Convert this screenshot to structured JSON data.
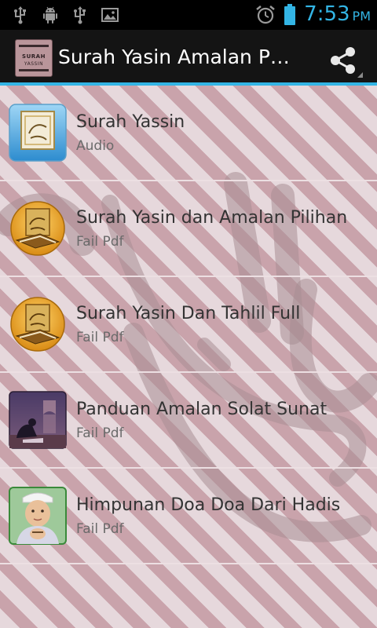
{
  "status_bar": {
    "icons": [
      "usb-icon",
      "android-debug-icon",
      "usb-icon",
      "image-icon",
      "alarm-icon",
      "battery-icon"
    ],
    "time": "7:53",
    "ampm": "PM"
  },
  "action_bar": {
    "app_icon_text_1": "SURAH",
    "app_icon_text_2": "YASSIN",
    "title": "Surah Yasin Amalan Pilihan",
    "share_icon": "share-icon"
  },
  "items": [
    {
      "title": "Surah Yassin",
      "subtitle": "Audio",
      "thumb": "quran-square-icon"
    },
    {
      "title": "Surah Yasin dan Amalan Pilihan",
      "subtitle": "Fail Pdf",
      "thumb": "quran-round-icon"
    },
    {
      "title": "Surah Yasin Dan Tahlil Full",
      "subtitle": "Fail Pdf",
      "thumb": "quran-round-icon"
    },
    {
      "title": "Panduan Amalan Solat Sunat",
      "subtitle": "Fail Pdf",
      "thumb": "praying-photo"
    },
    {
      "title": "Himpunan Doa Doa Dari Hadis",
      "subtitle": "Fail Pdf",
      "thumb": "child-praying-photo"
    }
  ],
  "colors": {
    "accent": "#33b5e5",
    "action_bar": "#141414",
    "text_primary": "#333333",
    "text_secondary": "#6a6a6a"
  }
}
